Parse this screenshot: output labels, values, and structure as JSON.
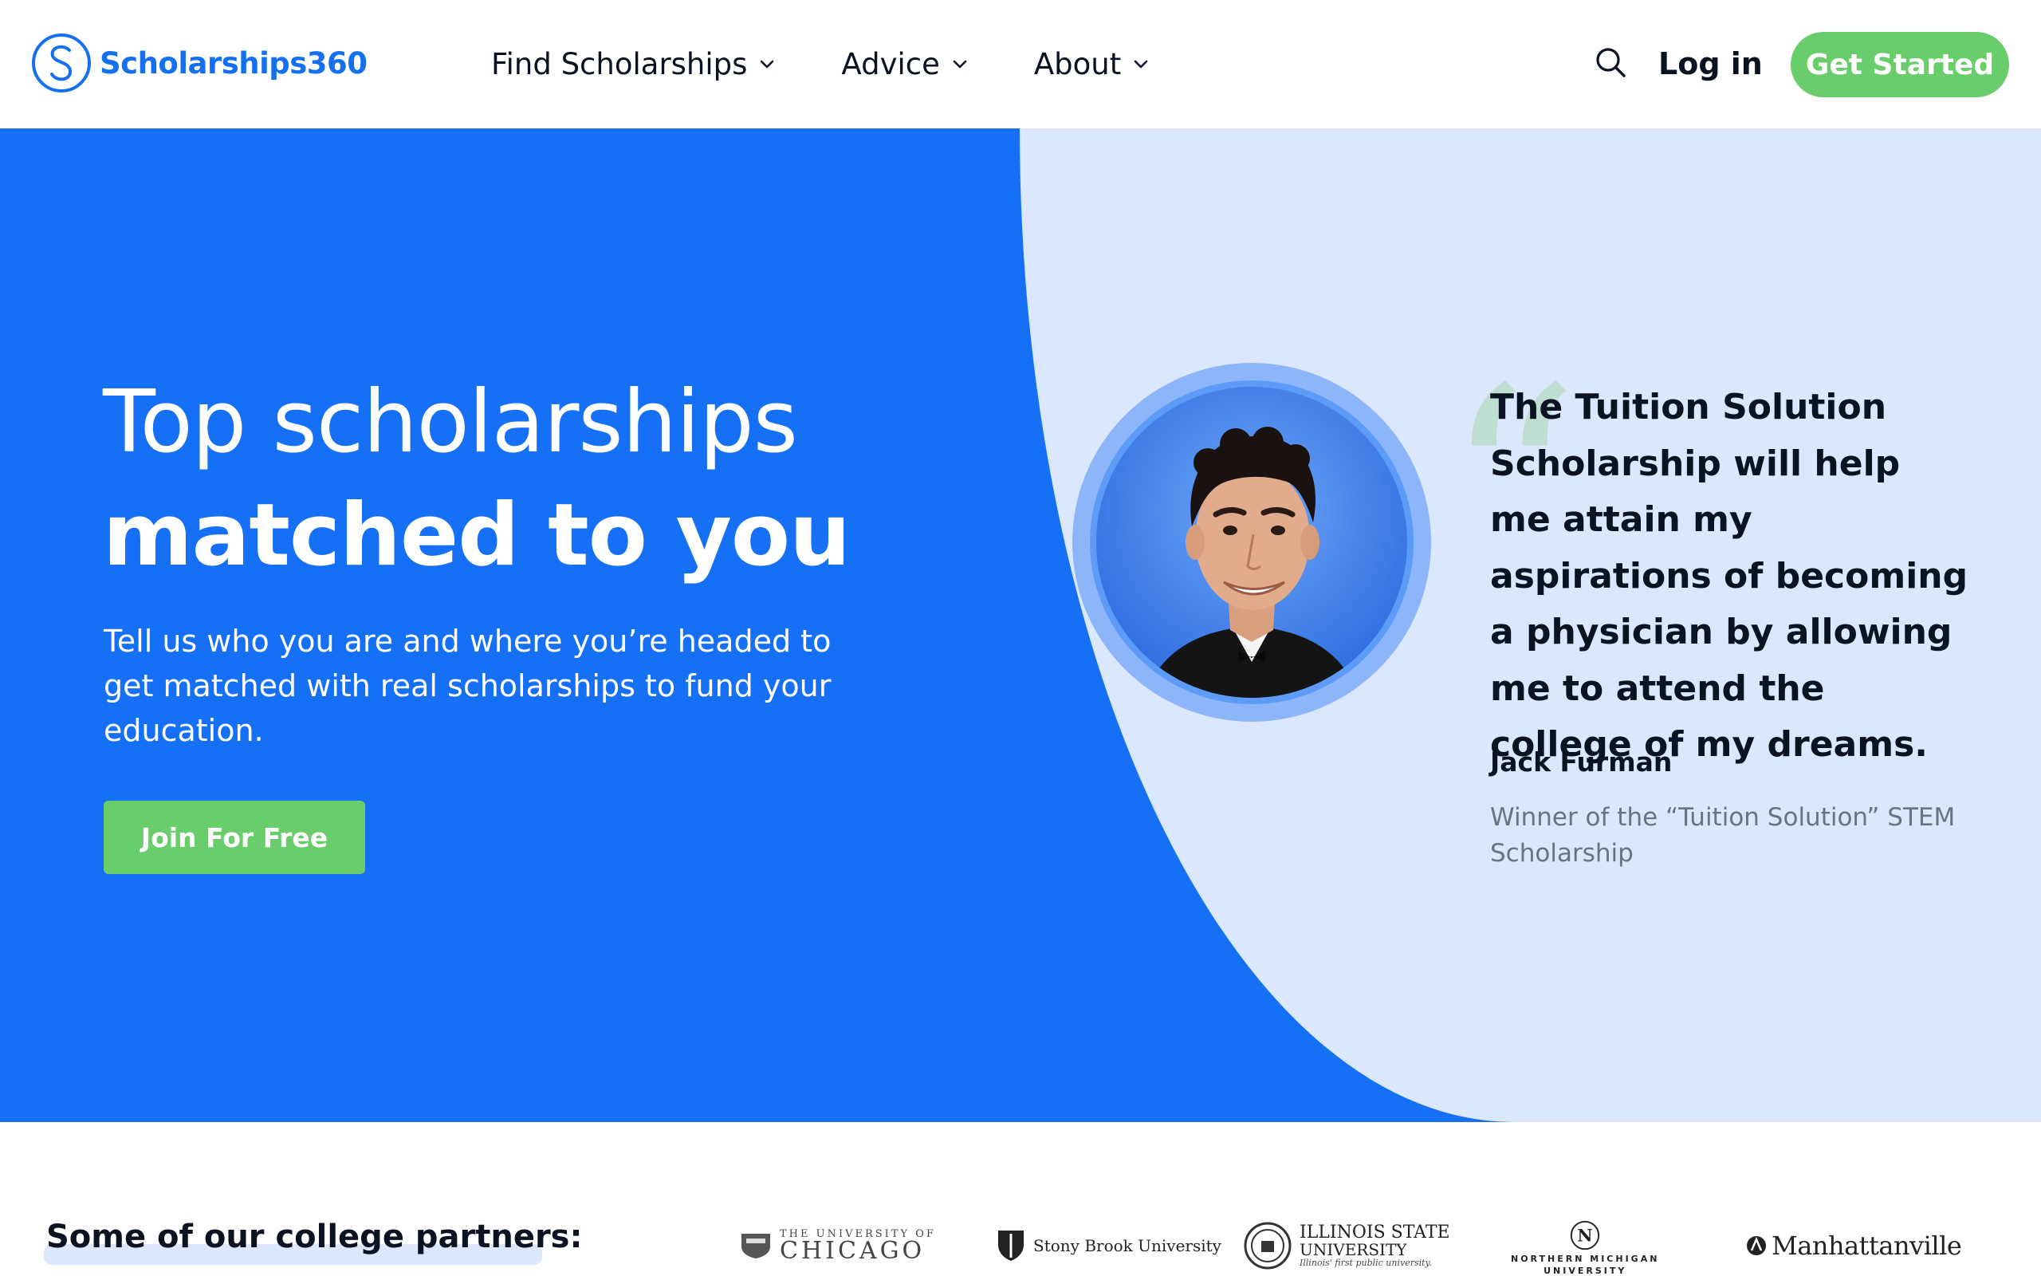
{
  "header": {
    "logo_text": "Scholarships360",
    "nav": [
      {
        "label": "Find Scholarships"
      },
      {
        "label": "Advice"
      },
      {
        "label": "About"
      }
    ],
    "login_label": "Log in",
    "cta_label": "Get Started"
  },
  "hero": {
    "title_line1": "Top scholarships",
    "title_line2": "matched to you",
    "subtitle": "Tell us who you are and where you’re headed to get matched with real scholarships to fund your education.",
    "button_label": "Join For Free"
  },
  "testimonial": {
    "quote": "The Tuition Solution Scholarship will help me attain my aspirations of becoming a physician by allowing me to attend the college of my dreams.",
    "author": "Jack Furman",
    "role": "Winner of the “Tuition Solution” STEM Scholarship"
  },
  "partners": {
    "title": "Some of our college partners:",
    "logos": [
      {
        "line1": "THE UNIVERSITY OF",
        "line2": "CHICAGO"
      },
      {
        "line1": "Stony Brook University",
        "line2": ""
      },
      {
        "line1": "ILLINOIS STATE",
        "line2": "UNIVERSITY",
        "line3": "Illinois' first public university."
      },
      {
        "line1": "NORTHERN MICHIGAN",
        "line2": "UNIVERSITY"
      },
      {
        "line1": "Manhattanville",
        "line2": ""
      }
    ]
  },
  "colors": {
    "brand_blue": "#1570f5",
    "light_blue": "#dbe7fd",
    "green": "#6acd6c"
  }
}
